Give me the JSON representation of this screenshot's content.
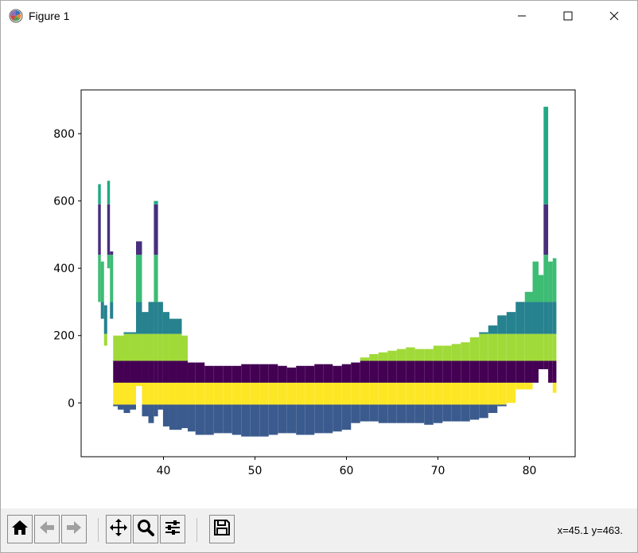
{
  "window": {
    "title": "Figure 1",
    "icons": {
      "app": "matplotlib-icon",
      "minimize": "minimize-icon",
      "maximize": "maximize-icon",
      "close": "close-icon"
    }
  },
  "toolbar": {
    "buttons": [
      {
        "name": "home",
        "icon": "home-icon"
      },
      {
        "name": "back",
        "icon": "back-arrow-icon"
      },
      {
        "name": "forward",
        "icon": "forward-arrow-icon"
      },
      {
        "name": "pan",
        "icon": "pan-icon"
      },
      {
        "name": "zoom",
        "icon": "zoom-icon"
      },
      {
        "name": "configure",
        "icon": "sliders-icon"
      },
      {
        "name": "save",
        "icon": "save-icon"
      }
    ],
    "coord_readout": "x=45.1 y=463."
  },
  "chart_data": {
    "type": "bar",
    "title": "",
    "xlabel": "",
    "ylabel": "",
    "xlim": [
      31,
      85
    ],
    "ylim": [
      -160,
      930
    ],
    "xticks": [
      40,
      50,
      60,
      70,
      80
    ],
    "yticks": [
      0,
      200,
      400,
      600,
      800
    ],
    "xtick_labels": [
      "40",
      "50",
      "60",
      "70",
      "80"
    ],
    "ytick_labels": [
      "0",
      "200",
      "400",
      "600",
      "800"
    ],
    "grid": false,
    "legend": "none",
    "bands": [
      {
        "color": "#3b5b8e",
        "low": -100,
        "high": -5
      },
      {
        "color": "#fde725",
        "low": -5,
        "high": 60
      },
      {
        "color": "#440154",
        "low": 60,
        "high": 125
      },
      {
        "color": "#a0da39",
        "low": 125,
        "high": 205
      },
      {
        "color": "#26828e",
        "low": 205,
        "high": 300
      },
      {
        "color": "#3dbc74",
        "low": 300,
        "high": 440
      },
      {
        "color": "#472f7d",
        "low": 440,
        "high": 590
      },
      {
        "color": "#22a884",
        "low": 590,
        "high": 900
      }
    ],
    "samples": {
      "x": [
        33,
        33.3,
        33.7,
        34,
        34.3,
        34.7,
        35.3,
        36,
        36.7,
        37.3,
        38,
        38.7,
        39.2,
        39.6,
        40.3,
        41,
        41.7,
        42.3,
        43,
        44,
        45,
        46,
        47,
        48,
        49,
        50,
        51,
        52,
        53,
        54,
        55,
        56,
        57,
        58,
        59,
        60,
        61,
        62,
        63,
        64,
        65,
        66,
        67,
        68,
        69,
        70,
        71,
        72,
        73,
        74,
        75,
        76,
        77,
        78,
        79,
        80,
        80.7,
        81.3,
        81.8,
        82.3,
        82.8
      ],
      "top": [
        650,
        420,
        290,
        660,
        450,
        200,
        200,
        210,
        210,
        480,
        270,
        300,
        600,
        300,
        270,
        250,
        250,
        200,
        120,
        120,
        110,
        110,
        110,
        110,
        115,
        115,
        115,
        115,
        110,
        105,
        110,
        110,
        115,
        115,
        110,
        115,
        120,
        135,
        145,
        150,
        155,
        160,
        165,
        160,
        160,
        170,
        170,
        175,
        180,
        195,
        210,
        230,
        260,
        270,
        300,
        330,
        420,
        380,
        880,
        420,
        430
      ],
      "bottom": [
        300,
        250,
        170,
        400,
        250,
        -10,
        -20,
        -30,
        -20,
        50,
        -40,
        -60,
        -40,
        -20,
        -70,
        -80,
        -80,
        -75,
        -85,
        -95,
        -95,
        -90,
        -90,
        -95,
        -100,
        -100,
        -100,
        -95,
        -90,
        -90,
        -95,
        -95,
        -90,
        -90,
        -85,
        -80,
        -60,
        -55,
        -55,
        -60,
        -60,
        -60,
        -60,
        -60,
        -65,
        -60,
        -55,
        -55,
        -55,
        -50,
        -45,
        -30,
        -10,
        0,
        40,
        40,
        60,
        100,
        100,
        60,
        30
      ]
    }
  }
}
